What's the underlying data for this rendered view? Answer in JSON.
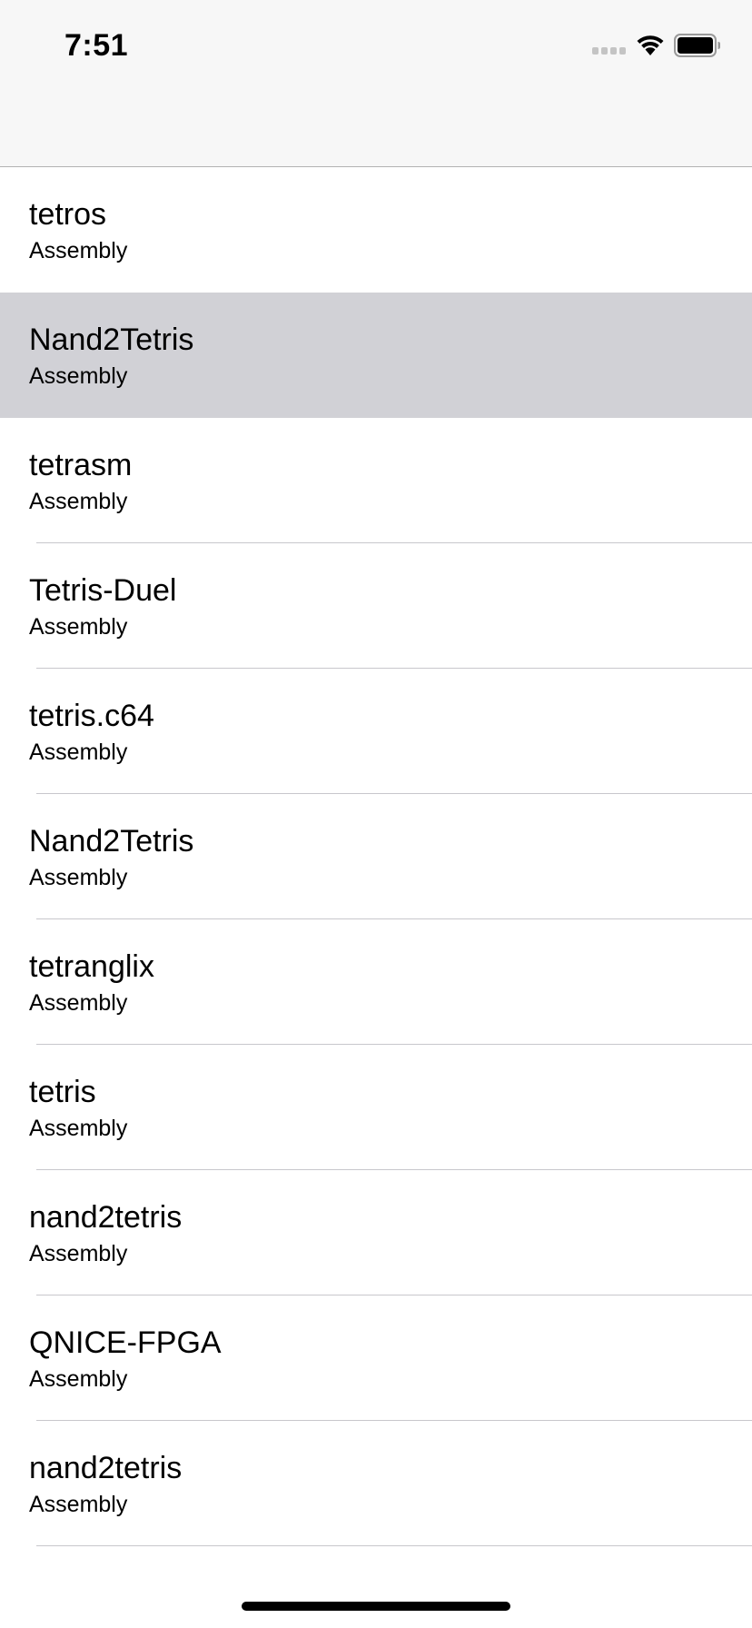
{
  "status_bar": {
    "time": "7:51",
    "icons": [
      "cellular-signal-icon",
      "wifi-icon",
      "battery-icon"
    ]
  },
  "repositories": [
    {
      "name": "tetros",
      "language": "Assembly",
      "selected": false
    },
    {
      "name": "Nand2Tetris",
      "language": "Assembly",
      "selected": true
    },
    {
      "name": "tetrasm",
      "language": "Assembly",
      "selected": false
    },
    {
      "name": "Tetris-Duel",
      "language": "Assembly",
      "selected": false
    },
    {
      "name": "tetris.c64",
      "language": "Assembly",
      "selected": false
    },
    {
      "name": "Nand2Tetris",
      "language": "Assembly",
      "selected": false
    },
    {
      "name": "tetranglix",
      "language": "Assembly",
      "selected": false
    },
    {
      "name": "tetris",
      "language": "Assembly",
      "selected": false
    },
    {
      "name": "nand2tetris",
      "language": "Assembly",
      "selected": false
    },
    {
      "name": "QNICE-FPGA",
      "language": "Assembly",
      "selected": false
    },
    {
      "name": "nand2tetris",
      "language": "Assembly",
      "selected": false
    }
  ],
  "colors": {
    "nav_background": "#f7f7f7",
    "selected_row": "#d1d1d6",
    "separator": "#c8c7cc"
  }
}
